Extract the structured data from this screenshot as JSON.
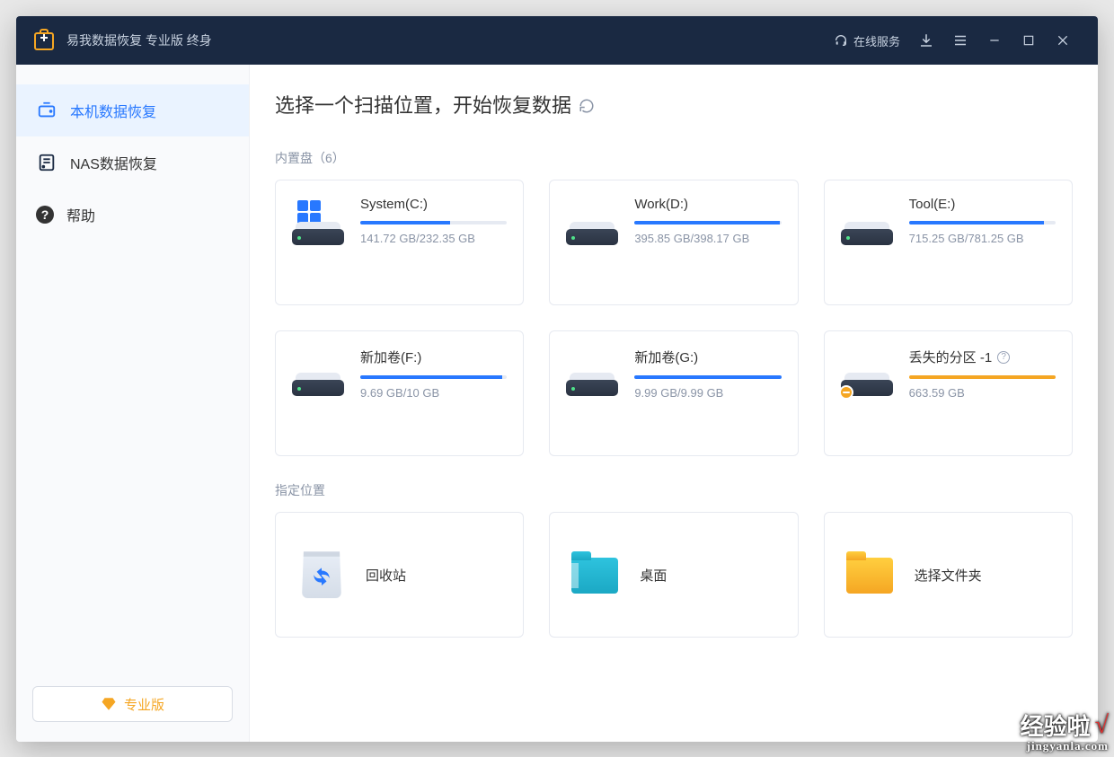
{
  "titlebar": {
    "app_name": "易我数据恢复 专业版 终身",
    "online_service": "在线服务"
  },
  "sidebar": {
    "items": [
      {
        "label": "本机数据恢复",
        "icon": "local-recovery-icon"
      },
      {
        "label": "NAS数据恢复",
        "icon": "nas-recovery-icon"
      },
      {
        "label": "帮助",
        "icon": "help-icon"
      }
    ],
    "pro_label": "专业版"
  },
  "main": {
    "title": "选择一个扫描位置，开始恢复数据",
    "section_internal": "内置盘（6）",
    "section_locations": "指定位置",
    "drives": [
      {
        "name": "System(C:)",
        "used": "141.72 GB",
        "total": "232.35 GB",
        "pct": 61,
        "system": true
      },
      {
        "name": "Work(D:)",
        "used": "395.85 GB",
        "total": "398.17 GB",
        "pct": 99
      },
      {
        "name": "Tool(E:)",
        "used": "715.25 GB",
        "total": "781.25 GB",
        "pct": 92
      },
      {
        "name": "新加卷(F:)",
        "used": "9.69 GB",
        "total": "10 GB",
        "pct": 97
      },
      {
        "name": "新加卷(G:)",
        "used": "9.99 GB",
        "total": "9.99 GB",
        "pct": 100
      },
      {
        "name": "丢失的分区 -1",
        "used": "663.59 GB",
        "total": "",
        "pct": 100,
        "lost": true
      }
    ],
    "locations": [
      {
        "label": "回收站",
        "icon": "recycle-bin-icon"
      },
      {
        "label": "桌面",
        "icon": "desktop-folder-icon"
      },
      {
        "label": "选择文件夹",
        "icon": "choose-folder-icon"
      }
    ]
  },
  "watermark": {
    "line1": "经验啦",
    "line2": "jingyanla.com"
  }
}
